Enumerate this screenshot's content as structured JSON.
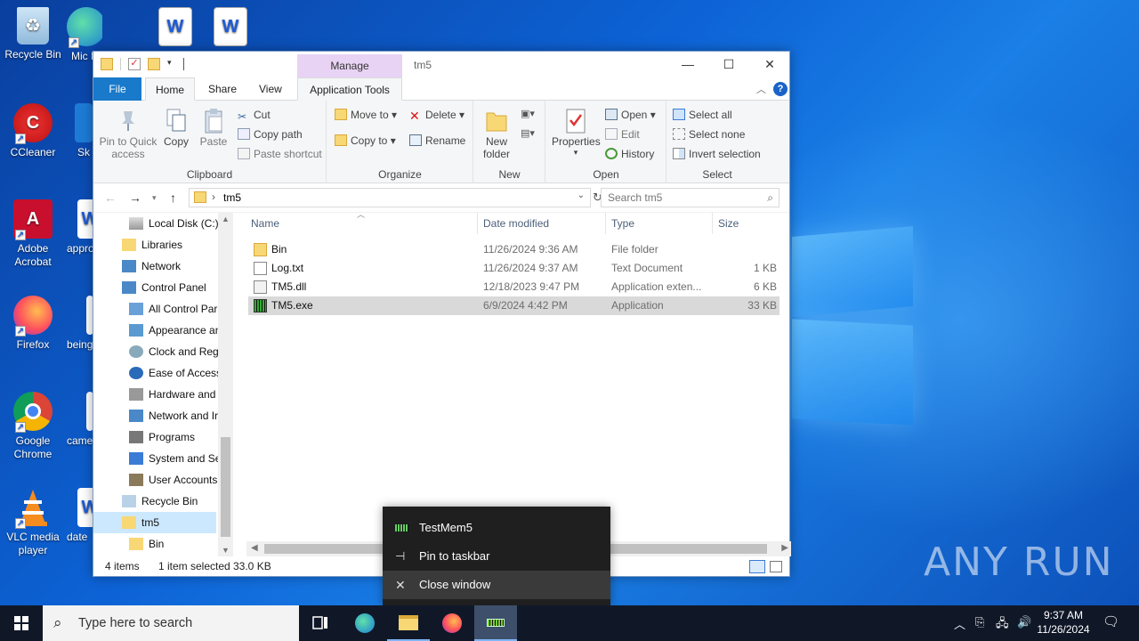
{
  "desktop": {
    "icons": [
      {
        "label": "Recycle Bin"
      },
      {
        "label": "Mic E"
      },
      {
        "label": "CCleaner"
      },
      {
        "label": "Sk"
      },
      {
        "label": "Adobe Acrobat"
      },
      {
        "label": "appro"
      },
      {
        "label": "Firefox"
      },
      {
        "label": "being"
      },
      {
        "label": "Google Chrome"
      },
      {
        "label": "came"
      },
      {
        "label": "VLC media player"
      },
      {
        "label": "date"
      }
    ]
  },
  "explorer": {
    "title": "tm5",
    "manage_label": "Manage",
    "tabs": {
      "file": "File",
      "home": "Home",
      "share": "Share",
      "view": "View",
      "app_tools": "Application Tools"
    },
    "ribbon": {
      "clipboard": {
        "label": "Clipboard",
        "pin": "Pin to Quick access",
        "copy": "Copy",
        "paste": "Paste",
        "cut": "Cut",
        "copy_path": "Copy path",
        "paste_shortcut": "Paste shortcut"
      },
      "organize": {
        "label": "Organize",
        "move_to": "Move to",
        "copy_to": "Copy to",
        "delete": "Delete",
        "rename": "Rename"
      },
      "new": {
        "label": "New",
        "new_folder": "New folder"
      },
      "open": {
        "label": "Open",
        "properties": "Properties",
        "open": "Open",
        "edit": "Edit",
        "history": "History"
      },
      "select": {
        "label": "Select",
        "select_all": "Select all",
        "select_none": "Select none",
        "invert": "Invert selection"
      }
    },
    "address": {
      "path": "tm5",
      "search_placeholder": "Search tm5"
    },
    "nav": [
      {
        "label": "Local Disk (C:)"
      },
      {
        "label": "Libraries"
      },
      {
        "label": "Network"
      },
      {
        "label": "Control Panel"
      },
      {
        "label": "All Control Par"
      },
      {
        "label": "Appearance an"
      },
      {
        "label": "Clock and Regi"
      },
      {
        "label": "Ease of Access"
      },
      {
        "label": "Hardware and"
      },
      {
        "label": "Network and Ir"
      },
      {
        "label": "Programs"
      },
      {
        "label": "System and Se"
      },
      {
        "label": "User Accounts"
      },
      {
        "label": "Recycle Bin"
      },
      {
        "label": "tm5"
      },
      {
        "label": "Bin"
      }
    ],
    "columns": {
      "name": "Name",
      "date": "Date modified",
      "type": "Type",
      "size": "Size"
    },
    "files": [
      {
        "name": "Bin",
        "date": "11/26/2024 9:36 AM",
        "type": "File folder",
        "size": ""
      },
      {
        "name": "Log.txt",
        "date": "11/26/2024 9:37 AM",
        "type": "Text Document",
        "size": "1 KB"
      },
      {
        "name": "TM5.dll",
        "date": "12/18/2023 9:47 PM",
        "type": "Application exten...",
        "size": "6 KB"
      },
      {
        "name": "TM5.exe",
        "date": "6/9/2024 4:42 PM",
        "type": "Application",
        "size": "33 KB"
      }
    ],
    "status": {
      "count": "4 items",
      "selected": "1 item selected",
      "size": "33.0 KB"
    }
  },
  "jumplist": {
    "app_name": "TestMem5",
    "pin": "Pin to taskbar",
    "close": "Close window"
  },
  "taskbar": {
    "search_placeholder": "Type here to search",
    "time": "9:37 AM",
    "date": "11/26/2024"
  },
  "watermark": "ANY RUN",
  "colors": {
    "accent": "#1979ca",
    "manage_tab": "#e8d3f4",
    "selected_row": "#d9d9d9",
    "nav_selected": "#cce8ff"
  }
}
